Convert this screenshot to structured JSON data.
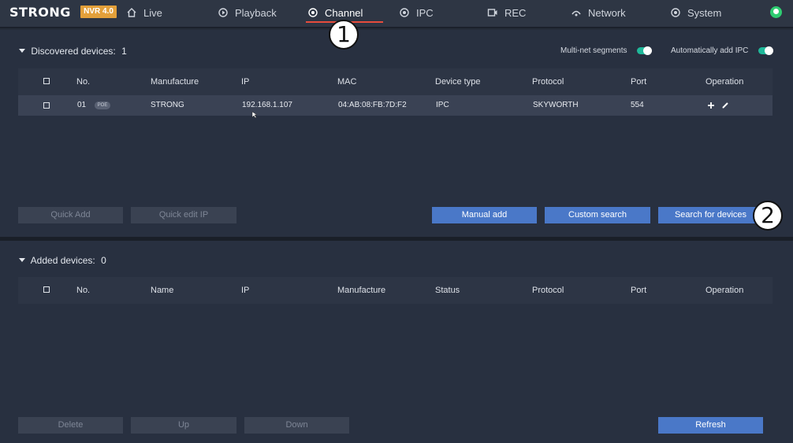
{
  "brand": {
    "logo": "STRONG",
    "badge": "NVR 4.0"
  },
  "nav": {
    "items": [
      {
        "label": "Live",
        "icon": "home-icon"
      },
      {
        "label": "Playback",
        "icon": "playback-icon"
      },
      {
        "label": "Channel",
        "icon": "channel-icon",
        "active": true
      },
      {
        "label": "IPC",
        "icon": "ipc-icon"
      },
      {
        "label": "REC",
        "icon": "rec-icon"
      },
      {
        "label": "Network",
        "icon": "network-icon"
      },
      {
        "label": "System",
        "icon": "system-icon"
      }
    ],
    "active_underline_color": "#e74c3c"
  },
  "annotations": [
    "1",
    "2"
  ],
  "discovered": {
    "title": "Discovered devices:",
    "count": "1",
    "toggles": {
      "multi_net": {
        "label": "Multi-net segments",
        "on": true
      },
      "auto_add": {
        "label": "Automatically add IPC",
        "on": true
      }
    },
    "columns": [
      "No.",
      "Manufacture",
      "IP",
      "MAC",
      "Device type",
      "Protocol",
      "Port",
      "Operation"
    ],
    "rows": [
      {
        "no": "01",
        "tag": "POE",
        "manufacture": "STRONG",
        "ip": "192.168.1.107",
        "mac": "04:AB:08:FB:7D:F2",
        "device_type": "IPC",
        "protocol": "SKYWORTH",
        "port": "554"
      }
    ],
    "buttons": {
      "quick_add": "Quick Add",
      "quick_edit_ip": "Quick edit IP",
      "manual_add": "Manual add",
      "custom_search": "Custom search",
      "search_devices": "Search for devices"
    }
  },
  "added": {
    "title": "Added devices:",
    "count": "0",
    "columns": [
      "No.",
      "Name",
      "IP",
      "Manufacture",
      "Status",
      "Protocol",
      "Port",
      "Operation"
    ],
    "buttons": {
      "delete": "Delete",
      "up": "Up",
      "down": "Down",
      "refresh": "Refresh"
    }
  },
  "colors": {
    "primary_button": "#4a78c8",
    "toggle_on": "#1fb89a",
    "badge": "#e3a03a"
  }
}
